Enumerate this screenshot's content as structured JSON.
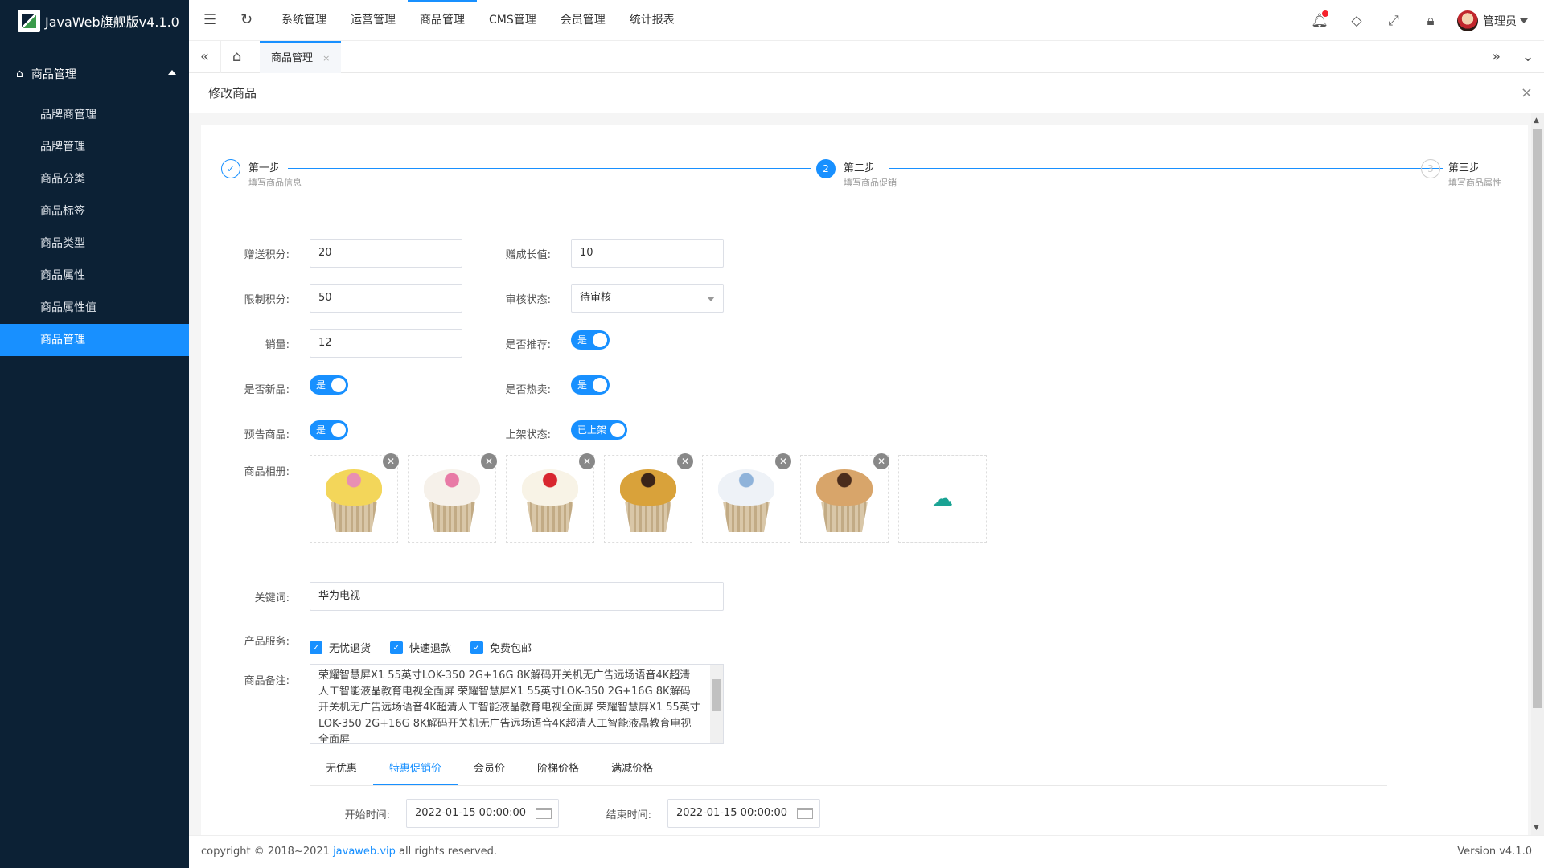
{
  "app": {
    "title": "JavaWeb旗舰版v4.1.0"
  },
  "sidebar": {
    "group": "商品管理",
    "items": [
      {
        "label": "品牌商管理"
      },
      {
        "label": "品牌管理"
      },
      {
        "label": "商品分类"
      },
      {
        "label": "商品标签"
      },
      {
        "label": "商品类型"
      },
      {
        "label": "商品属性"
      },
      {
        "label": "商品属性值"
      },
      {
        "label": "商品管理",
        "active": true
      }
    ]
  },
  "topnav": {
    "items": [
      "系统管理",
      "运营管理",
      "商品管理",
      "CMS管理",
      "会员管理",
      "统计报表"
    ],
    "active": "商品管理",
    "user": "管理员"
  },
  "tabs": {
    "current": "商品管理",
    "close": "×"
  },
  "page": {
    "title": "修改商品",
    "close": "×"
  },
  "steps": [
    {
      "title": "第一步",
      "desc": "填写商品信息",
      "status": "finish",
      "icon": "✓"
    },
    {
      "title": "第二步",
      "desc": "填写商品促销",
      "status": "process",
      "icon": "2"
    },
    {
      "title": "第三步",
      "desc": "填写商品属性",
      "status": "wait",
      "icon": "3"
    }
  ],
  "form": {
    "gift_points_label": "赠送积分:",
    "gift_points": "20",
    "growth_label": "赠成长值:",
    "growth": "10",
    "limit_points_label": "限制积分:",
    "limit_points": "50",
    "audit_label": "审核状态:",
    "audit": "待审核",
    "sales_label": "销量:",
    "sales": "12",
    "recommend_label": "是否推荐:",
    "recommend": "是",
    "new_label": "是否新品:",
    "new": "是",
    "hot_label": "是否热卖:",
    "hot": "是",
    "preview_label": "预告商品:",
    "preview": "是",
    "shelf_label": "上架状态:",
    "shelf": "已上架",
    "album_label": "商品相册:",
    "keywords_label": "关键词:",
    "keywords": "华为电视",
    "service_label": "产品服务:",
    "services": [
      "无忧退货",
      "快速退款",
      "免费包邮"
    ],
    "note_label": "商品备注:",
    "note": "荣耀智慧屏X1 55英寸LOK-350 2G+16G 8K解码开关机无广告远场语音4K超清人工智能液晶教育电视全面屏 荣耀智慧屏X1 55英寸LOK-350 2G+16G 8K解码开关机无广告远场语音4K超清人工智能液晶教育电视全面屏 荣耀智慧屏X1 55英寸LOK-350 2G+16G 8K解码开关机无广告远场语音4K超清人工智能液晶教育电视全面屏",
    "price_tabs": [
      "无优惠",
      "特惠促销价",
      "会员价",
      "阶梯价格",
      "满减价格"
    ],
    "price_tab_active": "特惠促销价",
    "start_label": "开始时间:",
    "start": "2022-01-15 00:00:00",
    "end_label": "结束时间:",
    "end": "2022-01-15 00:00:00"
  },
  "album_colors": [
    {
      "frost": "#f3d65a",
      "accent": "#e88fb3"
    },
    {
      "frost": "#f6f1ea",
      "accent": "#e87aa6"
    },
    {
      "frost": "#f8f3e6",
      "accent": "#d8262f"
    },
    {
      "frost": "#d9a23a",
      "accent": "#3a2418"
    },
    {
      "frost": "#eef2f7",
      "accent": "#8fb3da"
    },
    {
      "frost": "#d8a56a",
      "accent": "#4a2c1c"
    }
  ],
  "footer": {
    "copyright": "copyright © 2018~2021",
    "link": "javaweb.vip",
    "rights": "all rights reserved.",
    "version": "Version v4.1.0"
  },
  "colors": {
    "primary": "#1890ff",
    "sidebar": "#0c2135"
  }
}
